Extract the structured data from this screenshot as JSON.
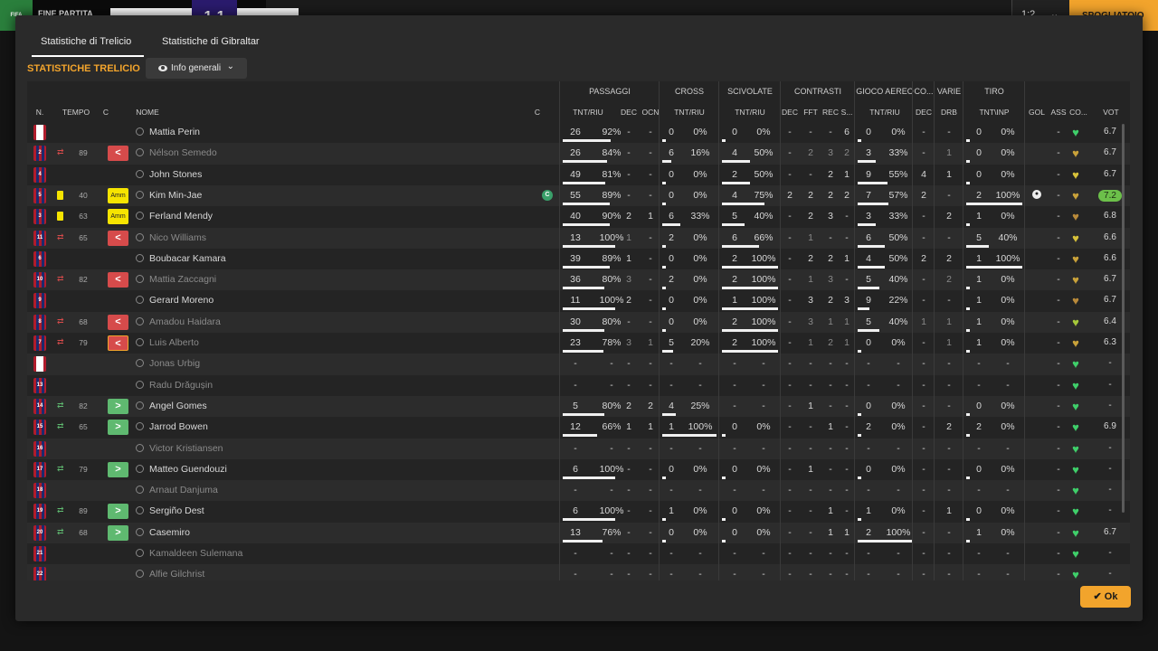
{
  "topbar": {
    "logo_text": "FIFA",
    "status": "FINE PARTITA",
    "home_short": "TRELIC",
    "score": "1-1",
    "away_short": "GIBRAL",
    "ctrl_1": "1:2",
    "ctrl_2": "⌄",
    "dressing_room": "SPOGLIATOIO"
  },
  "tabs": [
    {
      "label": "Statistiche di Trelicio",
      "active": true
    },
    {
      "label": "Statistiche di Gibraltar",
      "active": false
    }
  ],
  "section_title": "STATISTICHE TRELICIO",
  "view_dropdown": {
    "label": "Info generali",
    "icon": "eye-icon"
  },
  "groups": [
    {
      "label": "PASSAGGI"
    },
    {
      "label": "CROSS"
    },
    {
      "label": "SCIVOLATE"
    },
    {
      "label": "CONTRASTI"
    },
    {
      "label": "GIOCO AEREO"
    },
    {
      "label": "CO..."
    },
    {
      "label": "VARIE"
    },
    {
      "label": "TIRO"
    }
  ],
  "headers": [
    "N.",
    "TEMPO",
    "C",
    "NOME",
    "C",
    "TNT/RIU",
    "DEC",
    "OCN",
    "TNT/RIU",
    "TNT/RIU",
    "DEC",
    "FFT",
    "REC",
    "S...",
    "TNT/RIU",
    "DEC",
    "DRB",
    "TNT\\INP",
    "GOL",
    "ASS",
    "CO...",
    "VOT"
  ],
  "players": [
    {
      "num": "",
      "gk": true,
      "event": "",
      "minute": "",
      "badge": "",
      "name": "Mattia Perin",
      "dim": false,
      "captain": false,
      "pass": [
        "26",
        "92%"
      ],
      "pass_ratio": 0.92,
      "pdec": "-",
      "pocn": "-",
      "cross": [
        "0",
        "0%"
      ],
      "cross_ratio": 0,
      "tack": [
        "0",
        "0%"
      ],
      "tack_ratio": 0,
      "c1": "-",
      "c2": "-",
      "c3": "-",
      "c4": "6",
      "air": [
        "0",
        "0%"
      ],
      "air_ratio": 0,
      "codec": "-",
      "drb": "-",
      "shot": [
        "0",
        "0%"
      ],
      "shot_ratio": 0,
      "gol": "",
      "ass": "-",
      "rating": "6.7",
      "best": false,
      "heart_color": "#3fcf6a"
    },
    {
      "num": "2",
      "gk": false,
      "event": "out",
      "minute": "89",
      "badge": "out",
      "name": "Nélson Semedo",
      "dim": true,
      "captain": false,
      "pass": [
        "26",
        "84%"
      ],
      "pass_ratio": 0.84,
      "pdec": "-",
      "pocn": "-",
      "cross": [
        "6",
        "16%"
      ],
      "cross_ratio": 0.16,
      "tack": [
        "4",
        "50%"
      ],
      "tack_ratio": 0.5,
      "c1": "-",
      "c2": "2",
      "c3": "3",
      "c4": "2",
      "air": [
        "3",
        "33%"
      ],
      "air_ratio": 0.33,
      "codec": "-",
      "drb": "1",
      "shot": [
        "0",
        "0%"
      ],
      "shot_ratio": 0,
      "gol": "",
      "ass": "-",
      "rating": "6.7",
      "best": false,
      "heart_color": "#c9a23a"
    },
    {
      "num": "4",
      "gk": false,
      "event": "",
      "minute": "",
      "badge": "",
      "name": "John Stones",
      "dim": false,
      "captain": false,
      "pass": [
        "49",
        "81%"
      ],
      "pass_ratio": 0.81,
      "pdec": "-",
      "pocn": "-",
      "cross": [
        "0",
        "0%"
      ],
      "cross_ratio": 0,
      "tack": [
        "2",
        "50%"
      ],
      "tack_ratio": 0.5,
      "c1": "-",
      "c2": "-",
      "c3": "2",
      "c4": "1",
      "air": [
        "9",
        "55%"
      ],
      "air_ratio": 0.55,
      "codec": "4",
      "drb": "1",
      "shot": [
        "0",
        "0%"
      ],
      "shot_ratio": 0,
      "gol": "",
      "ass": "-",
      "rating": "6.7",
      "best": false,
      "heart_color": "#d8c23a"
    },
    {
      "num": "5",
      "gk": false,
      "event": "yellow",
      "minute": "40",
      "badge": "amm",
      "name": "Kim Min-Jae",
      "dim": false,
      "captain": true,
      "pass": [
        "55",
        "89%"
      ],
      "pass_ratio": 0.89,
      "pdec": "-",
      "pocn": "-",
      "cross": [
        "0",
        "0%"
      ],
      "cross_ratio": 0,
      "tack": [
        "4",
        "75%"
      ],
      "tack_ratio": 0.75,
      "c1": "2",
      "c2": "2",
      "c3": "2",
      "c4": "2",
      "air": [
        "7",
        "57%"
      ],
      "air_ratio": 0.57,
      "codec": "2",
      "drb": "-",
      "shot": [
        "2",
        "100%"
      ],
      "shot_ratio": 1,
      "gol": "ball",
      "ass": "-",
      "rating": "7.2",
      "best": true,
      "heart_color": "#c9a23a"
    },
    {
      "num": "3",
      "gk": false,
      "event": "yellow",
      "minute": "63",
      "badge": "amm",
      "name": "Ferland Mendy",
      "dim": false,
      "captain": false,
      "pass": [
        "40",
        "90%"
      ],
      "pass_ratio": 0.9,
      "pdec": "2",
      "pocn": "1",
      "cross": [
        "6",
        "33%"
      ],
      "cross_ratio": 0.33,
      "tack": [
        "5",
        "40%"
      ],
      "tack_ratio": 0.4,
      "c1": "-",
      "c2": "2",
      "c3": "3",
      "c4": "-",
      "air": [
        "3",
        "33%"
      ],
      "air_ratio": 0.33,
      "codec": "-",
      "drb": "2",
      "shot": [
        "1",
        "0%"
      ],
      "shot_ratio": 0,
      "gol": "",
      "ass": "-",
      "rating": "6.8",
      "best": false,
      "heart_color": "#b98a3a"
    },
    {
      "num": "11",
      "gk": false,
      "event": "out",
      "minute": "65",
      "badge": "out",
      "name": "Nico Williams",
      "dim": true,
      "captain": false,
      "pass": [
        "13",
        "100%"
      ],
      "pass_ratio": 1,
      "pdec": "1",
      "pocn": "-",
      "cross": [
        "2",
        "0%"
      ],
      "cross_ratio": 0,
      "tack": [
        "6",
        "66%"
      ],
      "tack_ratio": 0.66,
      "c1": "-",
      "c2": "1",
      "c3": "-",
      "c4": "-",
      "air": [
        "6",
        "50%"
      ],
      "air_ratio": 0.5,
      "codec": "-",
      "drb": "-",
      "shot": [
        "5",
        "40%"
      ],
      "shot_ratio": 0.4,
      "gol": "",
      "ass": "-",
      "rating": "6.6",
      "best": false,
      "heart_color": "#d8c23a"
    },
    {
      "num": "6",
      "gk": false,
      "event": "",
      "minute": "",
      "badge": "",
      "name": "Boubacar Kamara",
      "dim": false,
      "captain": false,
      "pass": [
        "39",
        "89%"
      ],
      "pass_ratio": 0.89,
      "pdec": "1",
      "pocn": "-",
      "cross": [
        "0",
        "0%"
      ],
      "cross_ratio": 0,
      "tack": [
        "2",
        "100%"
      ],
      "tack_ratio": 1,
      "c1": "-",
      "c2": "2",
      "c3": "2",
      "c4": "1",
      "air": [
        "4",
        "50%"
      ],
      "air_ratio": 0.5,
      "codec": "2",
      "drb": "2",
      "shot": [
        "1",
        "100%"
      ],
      "shot_ratio": 1,
      "gol": "",
      "ass": "-",
      "rating": "6.6",
      "best": false,
      "heart_color": "#c9a23a"
    },
    {
      "num": "10",
      "gk": false,
      "event": "out",
      "minute": "82",
      "badge": "out",
      "name": "Mattia Zaccagni",
      "dim": true,
      "captain": false,
      "pass": [
        "36",
        "80%"
      ],
      "pass_ratio": 0.8,
      "pdec": "3",
      "pocn": "-",
      "cross": [
        "2",
        "0%"
      ],
      "cross_ratio": 0,
      "tack": [
        "2",
        "100%"
      ],
      "tack_ratio": 1,
      "c1": "-",
      "c2": "1",
      "c3": "3",
      "c4": "-",
      "air": [
        "5",
        "40%"
      ],
      "air_ratio": 0.4,
      "codec": "-",
      "drb": "2",
      "shot": [
        "1",
        "0%"
      ],
      "shot_ratio": 0,
      "gol": "",
      "ass": "-",
      "rating": "6.7",
      "best": false,
      "heart_color": "#c9a23a"
    },
    {
      "num": "9",
      "gk": false,
      "event": "",
      "minute": "",
      "badge": "",
      "name": "Gerard Moreno",
      "dim": false,
      "captain": false,
      "pass": [
        "11",
        "100%"
      ],
      "pass_ratio": 1,
      "pdec": "2",
      "pocn": "-",
      "cross": [
        "0",
        "0%"
      ],
      "cross_ratio": 0,
      "tack": [
        "1",
        "100%"
      ],
      "tack_ratio": 1,
      "c1": "-",
      "c2": "3",
      "c3": "2",
      "c4": "3",
      "air": [
        "9",
        "22%"
      ],
      "air_ratio": 0.22,
      "codec": "-",
      "drb": "-",
      "shot": [
        "1",
        "0%"
      ],
      "shot_ratio": 0,
      "gol": "",
      "ass": "-",
      "rating": "6.7",
      "best": false,
      "heart_color": "#b98a3a"
    },
    {
      "num": "8",
      "gk": false,
      "event": "out",
      "minute": "68",
      "badge": "out",
      "name": "Amadou Haidara",
      "dim": true,
      "captain": false,
      "pass": [
        "30",
        "80%"
      ],
      "pass_ratio": 0.8,
      "pdec": "-",
      "pocn": "-",
      "cross": [
        "0",
        "0%"
      ],
      "cross_ratio": 0,
      "tack": [
        "2",
        "100%"
      ],
      "tack_ratio": 1,
      "c1": "-",
      "c2": "3",
      "c3": "1",
      "c4": "1",
      "air": [
        "5",
        "40%"
      ],
      "air_ratio": 0.4,
      "codec": "1",
      "drb": "1",
      "shot": [
        "1",
        "0%"
      ],
      "shot_ratio": 0,
      "gol": "",
      "ass": "-",
      "rating": "6.4",
      "best": false,
      "heart_color": "#a6c83a"
    },
    {
      "num": "7",
      "gk": false,
      "event": "out",
      "minute": "79",
      "badge": "out-outlined",
      "name": "Luis Alberto",
      "dim": true,
      "captain": false,
      "pass": [
        "23",
        "78%"
      ],
      "pass_ratio": 0.78,
      "pdec": "3",
      "pocn": "1",
      "cross": [
        "5",
        "20%"
      ],
      "cross_ratio": 0.2,
      "tack": [
        "2",
        "100%"
      ],
      "tack_ratio": 1,
      "c1": "-",
      "c2": "1",
      "c3": "2",
      "c4": "1",
      "air": [
        "0",
        "0%"
      ],
      "air_ratio": 0,
      "codec": "-",
      "drb": "1",
      "shot": [
        "1",
        "0%"
      ],
      "shot_ratio": 0,
      "gol": "",
      "ass": "-",
      "rating": "6.3",
      "best": false,
      "heart_color": "#c9a23a"
    },
    {
      "num": "",
      "gk": true,
      "event": "",
      "minute": "",
      "badge": "",
      "name": "Jonas Urbig",
      "dim": true,
      "captain": false,
      "pass": [
        "-",
        "-"
      ],
      "pass_ratio": null,
      "pdec": "-",
      "pocn": "-",
      "cross": [
        "-",
        "-"
      ],
      "cross_ratio": null,
      "tack": [
        "-",
        "-"
      ],
      "tack_ratio": null,
      "c1": "-",
      "c2": "-",
      "c3": "-",
      "c4": "-",
      "air": [
        "-",
        "-"
      ],
      "air_ratio": null,
      "codec": "-",
      "drb": "-",
      "shot": [
        "-",
        "-"
      ],
      "shot_ratio": null,
      "gol": "",
      "ass": "-",
      "rating": "-",
      "best": false,
      "heart_color": "#3fcf6a"
    },
    {
      "num": "13",
      "gk": false,
      "event": "",
      "minute": "",
      "badge": "",
      "name": "Radu Drăgușin",
      "dim": true,
      "captain": false,
      "pass": [
        "-",
        "-"
      ],
      "pass_ratio": null,
      "pdec": "-",
      "pocn": "-",
      "cross": [
        "-",
        "-"
      ],
      "cross_ratio": null,
      "tack": [
        "-",
        "-"
      ],
      "tack_ratio": null,
      "c1": "-",
      "c2": "-",
      "c3": "-",
      "c4": "-",
      "air": [
        "-",
        "-"
      ],
      "air_ratio": null,
      "codec": "-",
      "drb": "-",
      "shot": [
        "-",
        "-"
      ],
      "shot_ratio": null,
      "gol": "",
      "ass": "-",
      "rating": "-",
      "best": false,
      "heart_color": "#3fcf6a"
    },
    {
      "num": "14",
      "gk": false,
      "event": "in",
      "minute": "82",
      "badge": "in",
      "name": "Angel Gomes",
      "dim": false,
      "captain": false,
      "pass": [
        "5",
        "80%"
      ],
      "pass_ratio": 0.8,
      "pdec": "2",
      "pocn": "2",
      "cross": [
        "4",
        "25%"
      ],
      "cross_ratio": 0.25,
      "tack": [
        "-",
        "-"
      ],
      "tack_ratio": null,
      "c1": "-",
      "c2": "1",
      "c3": "-",
      "c4": "-",
      "air": [
        "0",
        "0%"
      ],
      "air_ratio": 0,
      "codec": "-",
      "drb": "-",
      "shot": [
        "0",
        "0%"
      ],
      "shot_ratio": 0,
      "gol": "",
      "ass": "-",
      "rating": "-",
      "best": false,
      "heart_color": "#3fcf6a"
    },
    {
      "num": "15",
      "gk": false,
      "event": "in",
      "minute": "65",
      "badge": "in",
      "name": "Jarrod Bowen",
      "dim": false,
      "captain": false,
      "pass": [
        "12",
        "66%"
      ],
      "pass_ratio": 0.66,
      "pdec": "1",
      "pocn": "1",
      "cross": [
        "1",
        "100%"
      ],
      "cross_ratio": 1,
      "tack": [
        "0",
        "0%"
      ],
      "tack_ratio": 0,
      "c1": "-",
      "c2": "-",
      "c3": "1",
      "c4": "-",
      "air": [
        "2",
        "0%"
      ],
      "air_ratio": 0,
      "codec": "-",
      "drb": "2",
      "shot": [
        "2",
        "0%"
      ],
      "shot_ratio": 0,
      "gol": "",
      "ass": "-",
      "rating": "6.9",
      "best": false,
      "heart_color": "#3fcf6a"
    },
    {
      "num": "16",
      "gk": false,
      "event": "",
      "minute": "",
      "badge": "",
      "name": "Victor Kristiansen",
      "dim": true,
      "captain": false,
      "pass": [
        "-",
        "-"
      ],
      "pass_ratio": null,
      "pdec": "-",
      "pocn": "-",
      "cross": [
        "-",
        "-"
      ],
      "cross_ratio": null,
      "tack": [
        "-",
        "-"
      ],
      "tack_ratio": null,
      "c1": "-",
      "c2": "-",
      "c3": "-",
      "c4": "-",
      "air": [
        "-",
        "-"
      ],
      "air_ratio": null,
      "codec": "-",
      "drb": "-",
      "shot": [
        "-",
        "-"
      ],
      "shot_ratio": null,
      "gol": "",
      "ass": "-",
      "rating": "-",
      "best": false,
      "heart_color": "#3fcf6a"
    },
    {
      "num": "17",
      "gk": false,
      "event": "in",
      "minute": "79",
      "badge": "in",
      "name": "Matteo Guendouzi",
      "dim": false,
      "captain": false,
      "pass": [
        "6",
        "100%"
      ],
      "pass_ratio": 1,
      "pdec": "-",
      "pocn": "-",
      "cross": [
        "0",
        "0%"
      ],
      "cross_ratio": 0,
      "tack": [
        "0",
        "0%"
      ],
      "tack_ratio": 0,
      "c1": "-",
      "c2": "1",
      "c3": "-",
      "c4": "-",
      "air": [
        "0",
        "0%"
      ],
      "air_ratio": 0,
      "codec": "-",
      "drb": "-",
      "shot": [
        "0",
        "0%"
      ],
      "shot_ratio": 0,
      "gol": "",
      "ass": "-",
      "rating": "-",
      "best": false,
      "heart_color": "#3fcf6a"
    },
    {
      "num": "18",
      "gk": false,
      "event": "",
      "minute": "",
      "badge": "",
      "name": "Arnaut Danjuma",
      "dim": true,
      "captain": false,
      "pass": [
        "-",
        "-"
      ],
      "pass_ratio": null,
      "pdec": "-",
      "pocn": "-",
      "cross": [
        "-",
        "-"
      ],
      "cross_ratio": null,
      "tack": [
        "-",
        "-"
      ],
      "tack_ratio": null,
      "c1": "-",
      "c2": "-",
      "c3": "-",
      "c4": "-",
      "air": [
        "-",
        "-"
      ],
      "air_ratio": null,
      "codec": "-",
      "drb": "-",
      "shot": [
        "-",
        "-"
      ],
      "shot_ratio": null,
      "gol": "",
      "ass": "-",
      "rating": "-",
      "best": false,
      "heart_color": "#3fcf6a"
    },
    {
      "num": "19",
      "gk": false,
      "event": "in",
      "minute": "89",
      "badge": "in",
      "name": "Sergiño Dest",
      "dim": false,
      "captain": false,
      "pass": [
        "6",
        "100%"
      ],
      "pass_ratio": 1,
      "pdec": "-",
      "pocn": "-",
      "cross": [
        "1",
        "0%"
      ],
      "cross_ratio": 0,
      "tack": [
        "0",
        "0%"
      ],
      "tack_ratio": 0,
      "c1": "-",
      "c2": "-",
      "c3": "1",
      "c4": "-",
      "air": [
        "1",
        "0%"
      ],
      "air_ratio": 0,
      "codec": "-",
      "drb": "1",
      "shot": [
        "0",
        "0%"
      ],
      "shot_ratio": 0,
      "gol": "",
      "ass": "-",
      "rating": "-",
      "best": false,
      "heart_color": "#3fcf6a"
    },
    {
      "num": "20",
      "gk": false,
      "event": "in",
      "minute": "68",
      "badge": "in",
      "name": "Casemiro",
      "dim": false,
      "captain": false,
      "pass": [
        "13",
        "76%"
      ],
      "pass_ratio": 0.76,
      "pdec": "-",
      "pocn": "-",
      "cross": [
        "0",
        "0%"
      ],
      "cross_ratio": 0,
      "tack": [
        "0",
        "0%"
      ],
      "tack_ratio": 0,
      "c1": "-",
      "c2": "-",
      "c3": "1",
      "c4": "1",
      "air": [
        "2",
        "100%"
      ],
      "air_ratio": 1,
      "codec": "-",
      "drb": "-",
      "shot": [
        "1",
        "0%"
      ],
      "shot_ratio": 0,
      "gol": "",
      "ass": "-",
      "rating": "6.7",
      "best": false,
      "heart_color": "#3fcf6a"
    },
    {
      "num": "21",
      "gk": false,
      "event": "",
      "minute": "",
      "badge": "",
      "name": "Kamaldeen Sulemana",
      "dim": true,
      "captain": false,
      "pass": [
        "-",
        "-"
      ],
      "pass_ratio": null,
      "pdec": "-",
      "pocn": "-",
      "cross": [
        "-",
        "-"
      ],
      "cross_ratio": null,
      "tack": [
        "-",
        "-"
      ],
      "tack_ratio": null,
      "c1": "-",
      "c2": "-",
      "c3": "-",
      "c4": "-",
      "air": [
        "-",
        "-"
      ],
      "air_ratio": null,
      "codec": "-",
      "drb": "-",
      "shot": [
        "-",
        "-"
      ],
      "shot_ratio": null,
      "gol": "",
      "ass": "-",
      "rating": "-",
      "best": false,
      "heart_color": "#3fcf6a"
    },
    {
      "num": "22",
      "gk": false,
      "event": "",
      "minute": "",
      "badge": "",
      "name": "Alfie Gilchrist",
      "dim": true,
      "captain": false,
      "pass": [
        "-",
        "-"
      ],
      "pass_ratio": null,
      "pdec": "-",
      "pocn": "-",
      "cross": [
        "-",
        "-"
      ],
      "cross_ratio": null,
      "tack": [
        "-",
        "-"
      ],
      "tack_ratio": null,
      "c1": "-",
      "c2": "-",
      "c3": "-",
      "c4": "-",
      "air": [
        "-",
        "-"
      ],
      "air_ratio": null,
      "codec": "-",
      "drb": "-",
      "shot": [
        "-",
        "-"
      ],
      "shot_ratio": null,
      "gol": "",
      "ass": "-",
      "rating": "-",
      "best": false,
      "heart_color": "#3fcf6a"
    }
  ],
  "badge_labels": {
    "amm": "Amm",
    "out": "<",
    "in": ">",
    "captain": "C",
    "ball": "●",
    "heart": "♥"
  },
  "ok_button": {
    "label": "✔ Ok"
  }
}
